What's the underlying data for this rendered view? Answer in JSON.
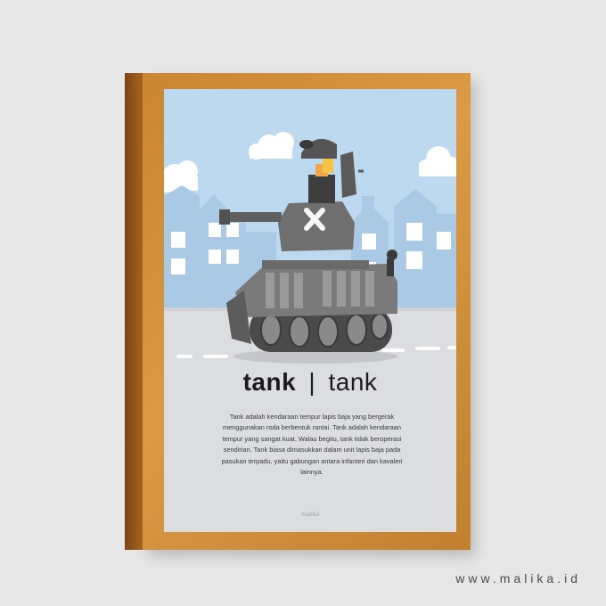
{
  "poster": {
    "title_bold": "tank",
    "divider": "|",
    "title_light": "tank",
    "description": "Tank adalah kendaraan tempur lapis baja yang bergerak menggunakan roda berbentuk rantai. Tank adalah kendaraan tempur yang sangat kuat. Walau begitu, tank tidak beroperasi sendirian. Tank biasa dimasukkan dalam unit lapis baja pada pasukan terpadu, yaitu gabungan antara infanteri dan kavaleri lainnya.",
    "signature": "malika"
  },
  "watermark": {
    "website": "www.malika.id"
  },
  "illustration": {
    "subject": "cartoon military tank with soldier on city street",
    "sky_color": "#bcd9ef",
    "building_color": "#a9c9e4",
    "road_color": "#dcdde0",
    "tank_color": "#727272",
    "frame_color": "#d08a35"
  }
}
